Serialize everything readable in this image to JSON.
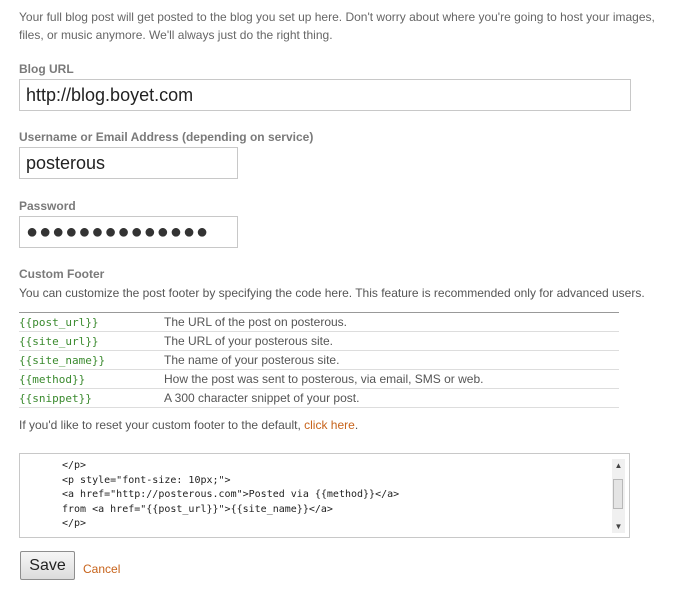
{
  "intro_text": "Your full blog post will get posted to the blog you set up here. Don't worry about where you're going to host your images, files, or music anymore. We'll always just do the right thing.",
  "blog_url": {
    "label": "Blog URL",
    "value": "http://blog.boyet.com"
  },
  "username": {
    "label": "Username or Email Address (depending on service)",
    "value": "posterous"
  },
  "password": {
    "label": "Password",
    "masked_value": "●●●●●●●●●●●●●●"
  },
  "custom_footer": {
    "label": "Custom Footer",
    "description": "You can customize the post footer by specifying the code here. This feature is recommended only for advanced users.",
    "variables": [
      {
        "name": "{{post_url}}",
        "description": "The URL of the post on posterous."
      },
      {
        "name": "{{site_url}}",
        "description": "The URL of your posterous site."
      },
      {
        "name": "{{site_name}}",
        "description": "The name of your posterous site."
      },
      {
        "name": "{{method}}",
        "description": "How the post was sent to posterous, via email, SMS or web."
      },
      {
        "name": "{{snippet}}",
        "description": "A 300 character snippet of your post."
      }
    ],
    "reset_text": "If you'd like to reset your custom footer to the default,",
    "reset_link": "click here",
    "reset_period": ".",
    "code": "</p>\n<p style=\"font-size: 10px;\">\n<a href=\"http://posterous.com\">Posted via {{method}}</a>\nfrom <a href=\"{{post_url}}\">{{site_name}}</a>\n</p>"
  },
  "buttons": {
    "save": "Save",
    "cancel": "Cancel"
  },
  "icons": {
    "scroll_up": "▲",
    "scroll_down": "▼"
  },
  "colors": {
    "link": "#c7631b",
    "variable": "#3a8a2e"
  }
}
